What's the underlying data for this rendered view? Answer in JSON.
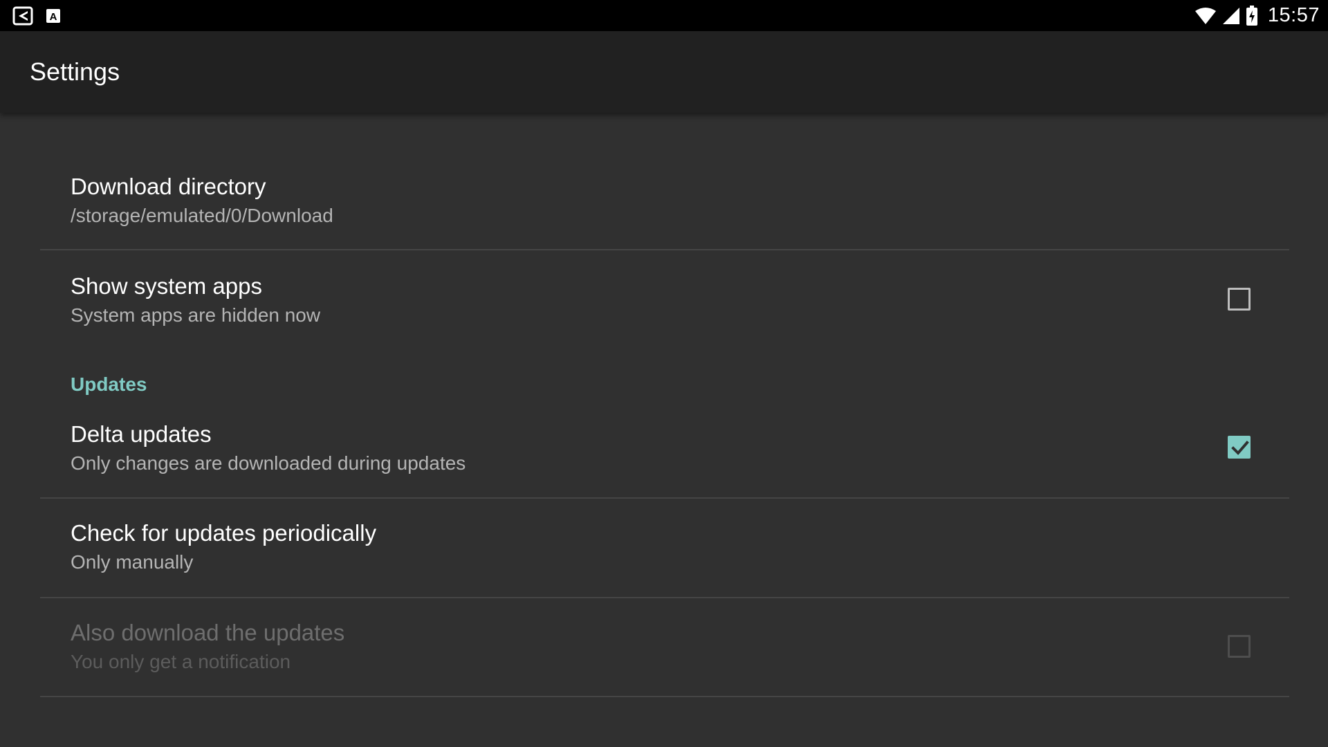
{
  "status_bar": {
    "left_icons": [
      "app-notification-icon",
      "keyboard-a-icon"
    ],
    "right_icons": [
      "wifi-icon",
      "cell-signal-icon",
      "battery-charging-icon"
    ],
    "time": "15:57"
  },
  "toolbar": {
    "title": "Settings"
  },
  "colors": {
    "accent": "#80cbc4",
    "background": "#303030",
    "toolbar": "#212121",
    "status_bar": "#000000"
  },
  "settings": {
    "download_directory": {
      "title": "Download directory",
      "summary": "/storage/emulated/0/Download"
    },
    "show_system_apps": {
      "title": "Show system apps",
      "summary": "System apps are hidden now",
      "checked": false
    },
    "updates_category": "Updates",
    "delta_updates": {
      "title": "Delta updates",
      "summary": "Only changes are downloaded during updates",
      "checked": true
    },
    "check_periodically": {
      "title": "Check for updates periodically",
      "summary": "Only manually"
    },
    "also_download": {
      "title": "Also download the updates",
      "summary": "You only get a notification",
      "checked": false,
      "enabled": false
    }
  }
}
